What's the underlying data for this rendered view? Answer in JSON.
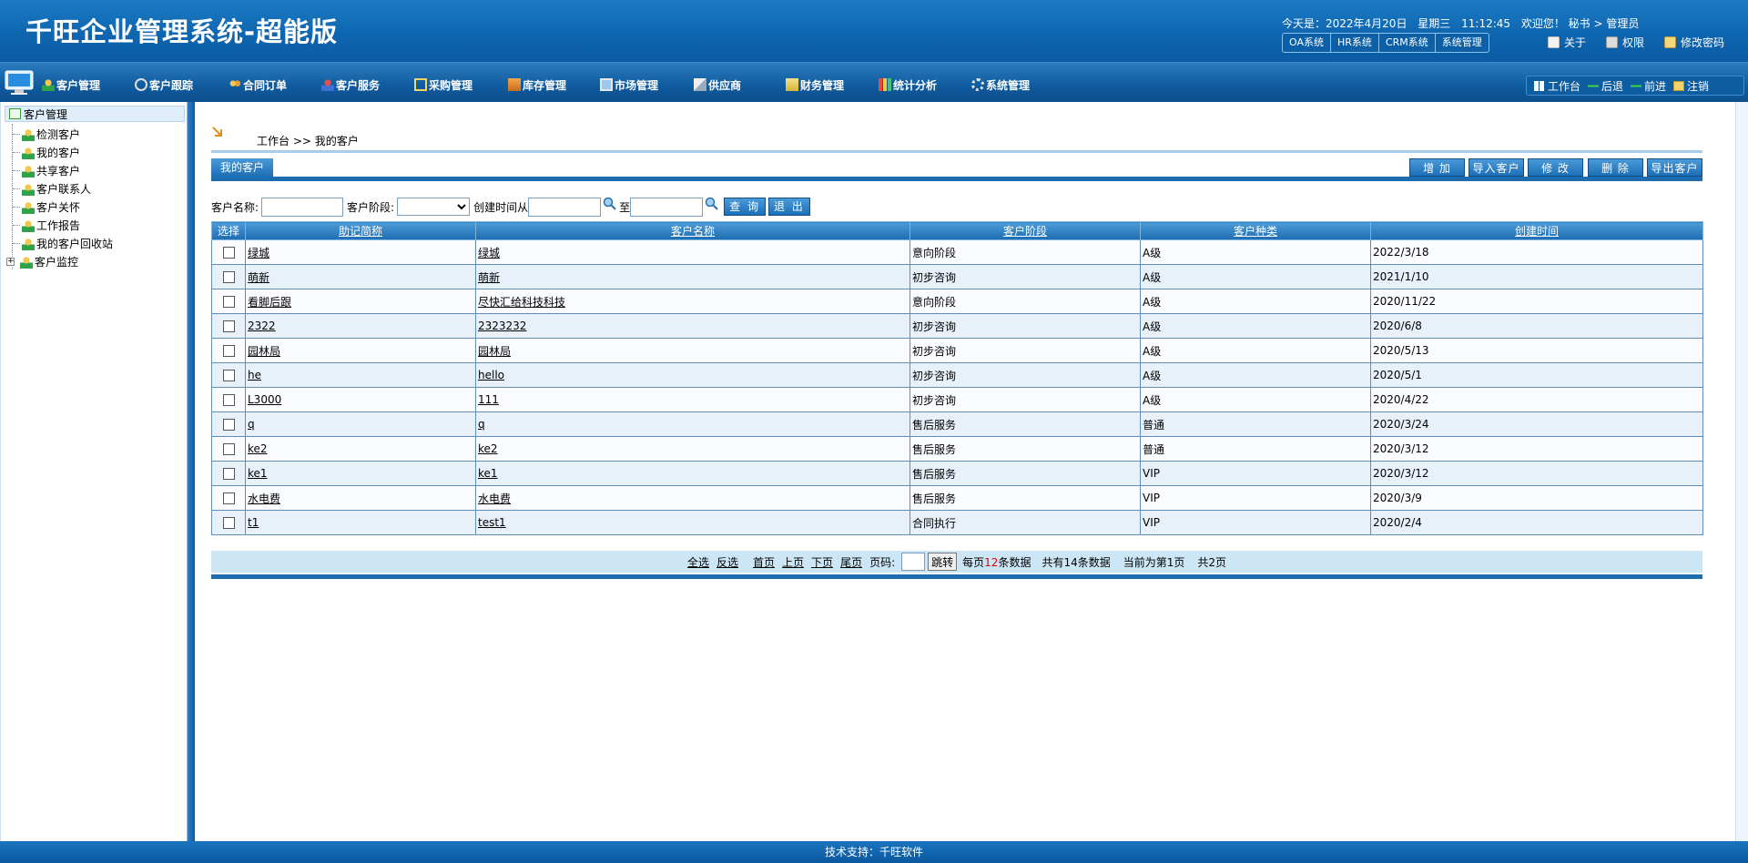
{
  "header": {
    "title": "千旺企业管理系统-超能版",
    "date_label": "今天是：2022年4月20日",
    "weekday": "星期三",
    "time": "11:12:45",
    "welcome": "欢迎您！ 秘书 > 管理员",
    "sys_tabs": [
      "OA系统",
      "HR系统",
      "CRM系统",
      "系统管理"
    ],
    "links": {
      "about": "关于",
      "permission": "权限",
      "change_password": "修改密码"
    }
  },
  "nav": {
    "items": [
      "客户管理",
      "客户跟踪",
      "合同订单",
      "客户服务",
      "采购管理",
      "库存管理",
      "市场管理",
      "供应商",
      "财务管理",
      "统计分析",
      "系统管理"
    ],
    "right": {
      "workbench": "工作台",
      "back": "后退",
      "forward": "前进",
      "logout": "注销"
    }
  },
  "sidebar": {
    "root": "客户管理",
    "items": [
      "检测客户",
      "我的客户",
      "共享客户",
      "客户联系人",
      "客户关怀",
      "工作报告",
      "我的客户回收站",
      "客户监控"
    ]
  },
  "main": {
    "breadcrumb": "工作台 >> 我的客户",
    "section_title": "我的客户",
    "actions": {
      "add": "增 加",
      "import": "导入客户",
      "edit": "修 改",
      "delete": "删 除",
      "export": "导出客户"
    },
    "search": {
      "name_label": "客户名称:",
      "stage_label": "客户阶段:",
      "time_from_label": "创建时间从",
      "time_to_label": "至",
      "query_btn": "查 询",
      "exit_btn": "退 出"
    },
    "table": {
      "headers": [
        "选择",
        "助记简称",
        "客户名称",
        "客户阶段",
        "客户种类",
        "创建时间"
      ],
      "rows": [
        [
          "绿城",
          "绿城",
          "意向阶段",
          "A级",
          "2022/3/18"
        ],
        [
          "萌新",
          "萌新",
          "初步咨询",
          "A级",
          "2021/1/10"
        ],
        [
          "看脚后跟",
          "尽快汇给科技科技",
          "意向阶段",
          "A级",
          "2020/11/22"
        ],
        [
          "2322",
          "2323232",
          "初步咨询",
          "A级",
          "2020/6/8"
        ],
        [
          "园林局",
          "园林局",
          "初步咨询",
          "A级",
          "2020/5/13"
        ],
        [
          "he",
          "hello",
          "初步咨询",
          "A级",
          "2020/5/1"
        ],
        [
          "L3000",
          "111",
          "初步咨询",
          "A级",
          "2020/4/22"
        ],
        [
          "q",
          "q",
          "售后服务",
          "普通",
          "2020/3/24"
        ],
        [
          "ke2",
          "ke2",
          "售后服务",
          "普通",
          "2020/3/12"
        ],
        [
          "ke1",
          "ke1",
          "售后服务",
          "VIP",
          "2020/3/12"
        ],
        [
          "水电费",
          "水电费",
          "售后服务",
          "VIP",
          "2020/3/9"
        ],
        [
          "t1",
          "test1",
          "合同执行",
          "VIP",
          "2020/2/4"
        ]
      ]
    },
    "pager": {
      "select_all": "全选",
      "invert": "反选",
      "first": "首页",
      "prev": "上页",
      "next": "下页",
      "last": "尾页",
      "page_label": "页码:",
      "jump": "跳转",
      "per_page_prefix": "每页",
      "per_page": "12",
      "per_page_suffix": "条数据",
      "total": "共有14条数据",
      "current": "当前为第1页",
      "pages": "共2页"
    }
  },
  "footer": {
    "text": "技术支持：千旺软件"
  },
  "colors": {
    "primary": "#0f66b0",
    "row_alt": "#e8f1fa",
    "pager_bg": "#cde6f5",
    "accent_red": "#e00000"
  }
}
